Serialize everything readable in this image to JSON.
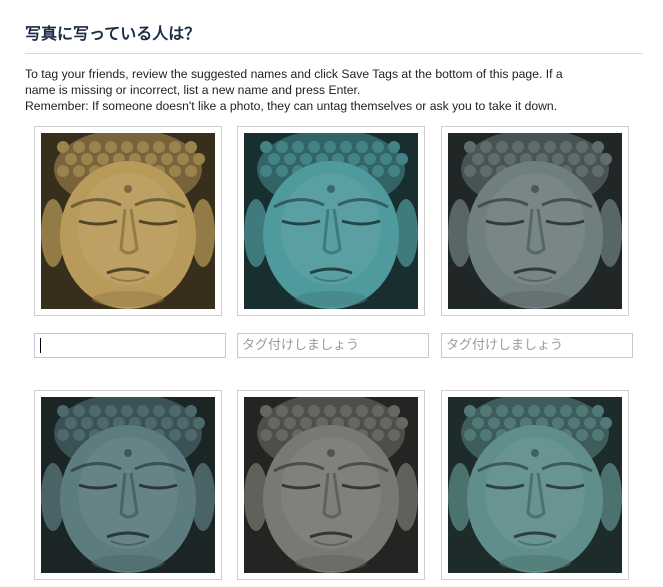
{
  "header": {
    "title": "写真に写っている人は？"
  },
  "instructions": {
    "line1": "To tag your friends, review the suggested names and click Save Tags at the bottom of this page. If a",
    "line2": "name is missing or incorrect, list a new name and press Enter.",
    "line3": "Remember: If someone doesn't like a photo, they can untag themselves or ask you to take it down."
  },
  "tag_inputs": [
    {
      "value": "",
      "placeholder": ""
    },
    {
      "value": "",
      "placeholder": "タグ付けしましょう"
    },
    {
      "value": "",
      "placeholder": "タグ付けしましょう"
    }
  ],
  "photos": [
    {
      "subject": "buddha-face",
      "tone": "#b89a5a"
    },
    {
      "subject": "buddha-face",
      "tone": "#4f9a9c"
    },
    {
      "subject": "buddha-face",
      "tone": "#6f7f80"
    },
    {
      "subject": "buddha-face",
      "tone": "#5c7c80"
    },
    {
      "subject": "buddha-face",
      "tone": "#7a7872"
    },
    {
      "subject": "buddha-face",
      "tone": "#5f8e8c"
    }
  ]
}
